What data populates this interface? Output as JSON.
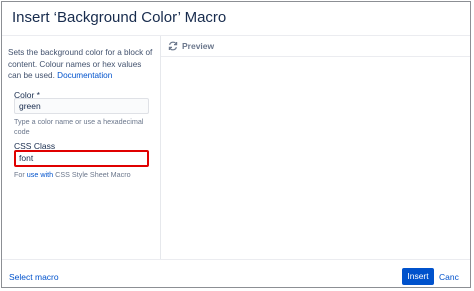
{
  "dialog": {
    "title": "Insert ‘Background Color’ Macro"
  },
  "left_panel": {
    "description": "Sets the background color for a block of content. Colour names or hex values can be used.",
    "documentation_link": "Documentation",
    "color_label": "Color *",
    "color_value": "green",
    "color_hint": "Type a color name or use a hexadecimal code",
    "css_label": "CSS Class",
    "css_value": "font",
    "css_hint_prefix": "For",
    "css_hint_link": "use with",
    "css_hint_suffix": "CSS Style Sheet Macro"
  },
  "preview": {
    "label": "Preview",
    "icon": "refresh-icon"
  },
  "footer": {
    "select_macro": "Select macro",
    "insert_label": "Insert",
    "cancel_label": "Canc"
  },
  "colors": {
    "accent": "#0052cc",
    "error_border": "#e00000"
  }
}
